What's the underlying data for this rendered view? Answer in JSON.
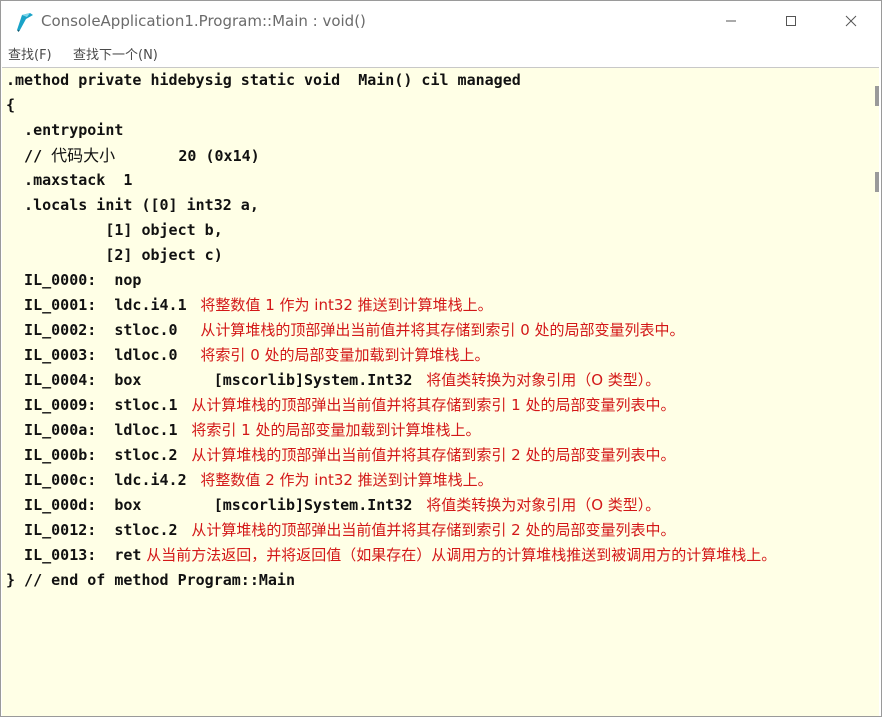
{
  "window": {
    "title": "ConsoleApplication1.Program::Main : void()"
  },
  "menu": {
    "find": "查找(F)",
    "find_next": "查找下一个(N)"
  },
  "code": {
    "header": ".method private hidebysig static void  Main() cil managed",
    "open_brace": "{",
    "entrypoint": "  .entrypoint",
    "codesize_prefix": "  // ",
    "codesize_label": "代码大小",
    "codesize_value": "       20 (0x14)",
    "maxstack": "  .maxstack  1",
    "locals_0": "  .locals init ([0] int32 a,",
    "locals_1": "           [1] object b,",
    "locals_2": "           [2] object c)",
    "instructions": [
      {
        "code": "  IL_0000:  nop",
        "comment": ""
      },
      {
        "code": "  IL_0001:  ldc.i4.1 ",
        "comment": " 将整数值 1 作为 int32 推送到计算堆栈上。"
      },
      {
        "code": "  IL_0002:  stloc.0  ",
        "comment": " 从计算堆栈的顶部弹出当前值并将其存储到索引 0 处的局部变量列表中。"
      },
      {
        "code": "  IL_0003:  ldloc.0  ",
        "comment": " 将索引 0 处的局部变量加载到计算堆栈上。"
      },
      {
        "code": "  IL_0004:  box        [mscorlib]System.Int32 ",
        "comment": " 将值类转换为对象引用（O 类型）。"
      },
      {
        "code": "  IL_0009:  stloc.1 ",
        "comment": " 从计算堆栈的顶部弹出当前值并将其存储到索引 1 处的局部变量列表中。"
      },
      {
        "code": "  IL_000a:  ldloc.1 ",
        "comment": " 将索引 1 处的局部变量加载到计算堆栈上。"
      },
      {
        "code": "  IL_000b:  stloc.2 ",
        "comment": " 从计算堆栈的顶部弹出当前值并将其存储到索引 2 处的局部变量列表中。"
      },
      {
        "code": "  IL_000c:  ldc.i4.2 ",
        "comment": " 将整数值 2 作为 int32 推送到计算堆栈上。"
      },
      {
        "code": "  IL_000d:  box        [mscorlib]System.Int32 ",
        "comment": " 将值类转换为对象引用（O 类型）。"
      },
      {
        "code": "  IL_0012:  stloc.2 ",
        "comment": " 从计算堆栈的顶部弹出当前值并将其存储到索引 2 处的局部变量列表中。"
      },
      {
        "code": "  IL_0013:  ret",
        "comment": " 从当前方法返回，并将返回值（如果存在）从调用方的计算堆栈推送到被调用方的计算堆栈上。"
      }
    ],
    "footer": "} // end of method Program::Main"
  },
  "colors": {
    "code_background": "#ffffe6",
    "comment": "#d31818",
    "code_text": "#111111",
    "icon_accent": "#1aa3c8"
  }
}
